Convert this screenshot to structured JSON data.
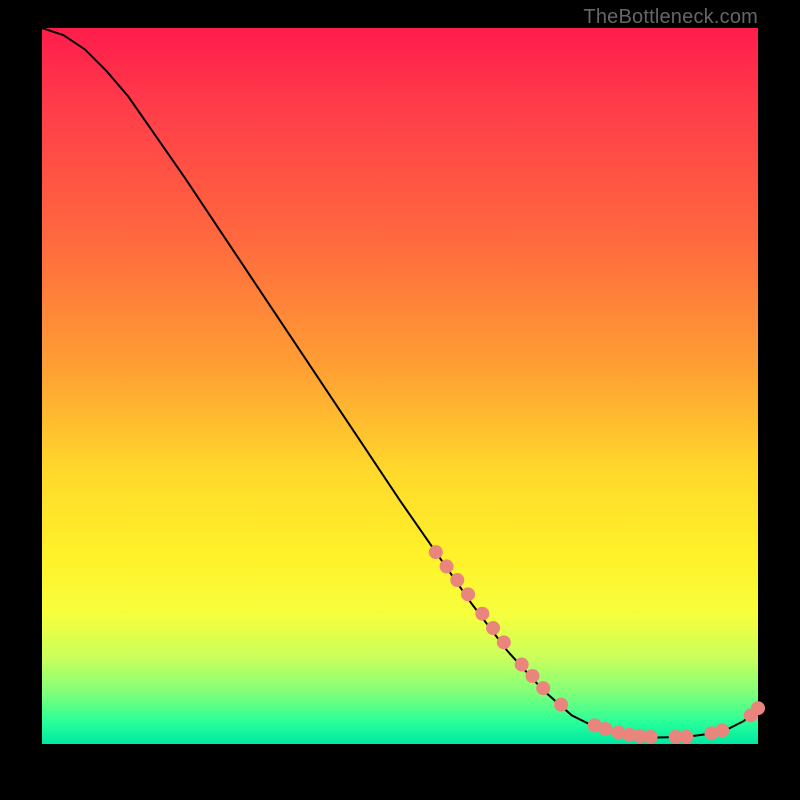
{
  "watermark": "TheBottleneck.com",
  "colors": {
    "background": "#000000",
    "gradient_top": "#ff1c4c",
    "gradient_mid1": "#ff6a3e",
    "gradient_mid2": "#ffd92b",
    "gradient_bottom": "#00e8a3",
    "curve": "#000000",
    "dots": "#e9857d"
  },
  "chart_data": {
    "type": "line",
    "title": "",
    "xlabel": "",
    "ylabel": "",
    "xlim": [
      0,
      100
    ],
    "ylim": [
      0,
      100
    ],
    "grid": false,
    "legend": false,
    "note": "x/y are percentages of the plot box; y origin is the bottom of the gradient. Curve descends from top-left to a flat trough near bottom-right, then ticks upward at the far right.",
    "curve_points": [
      {
        "x": 0,
        "y": 100
      },
      {
        "x": 3,
        "y": 99
      },
      {
        "x": 6,
        "y": 97
      },
      {
        "x": 9,
        "y": 94
      },
      {
        "x": 12,
        "y": 90.5
      },
      {
        "x": 15,
        "y": 86.2
      },
      {
        "x": 20,
        "y": 79
      },
      {
        "x": 25,
        "y": 71.5
      },
      {
        "x": 30,
        "y": 64
      },
      {
        "x": 35,
        "y": 56.5
      },
      {
        "x": 40,
        "y": 49
      },
      {
        "x": 45,
        "y": 41.5
      },
      {
        "x": 50,
        "y": 34
      },
      {
        "x": 55,
        "y": 26.8
      },
      {
        "x": 60,
        "y": 19.6
      },
      {
        "x": 65,
        "y": 13
      },
      {
        "x": 70,
        "y": 7.5
      },
      {
        "x": 74,
        "y": 4
      },
      {
        "x": 78,
        "y": 2
      },
      {
        "x": 82,
        "y": 1.1
      },
      {
        "x": 86,
        "y": 0.9
      },
      {
        "x": 90,
        "y": 1
      },
      {
        "x": 93,
        "y": 1.4
      },
      {
        "x": 96,
        "y": 2.2
      },
      {
        "x": 98,
        "y": 3.2
      },
      {
        "x": 100,
        "y": 5
      }
    ],
    "highlight_dots": [
      {
        "x": 55,
        "y": 26.8
      },
      {
        "x": 56.5,
        "y": 24.8
      },
      {
        "x": 58,
        "y": 22.9
      },
      {
        "x": 59.5,
        "y": 20.9
      },
      {
        "x": 61.5,
        "y": 18.2
      },
      {
        "x": 63,
        "y": 16.2
      },
      {
        "x": 64.5,
        "y": 14.2
      },
      {
        "x": 67,
        "y": 11.1
      },
      {
        "x": 68.5,
        "y": 9.5
      },
      {
        "x": 70,
        "y": 7.8
      },
      {
        "x": 72.5,
        "y": 5.5
      },
      {
        "x": 77.2,
        "y": 2.6
      },
      {
        "x": 78.7,
        "y": 2.1
      },
      {
        "x": 80.5,
        "y": 1.6
      },
      {
        "x": 82,
        "y": 1.3
      },
      {
        "x": 83.5,
        "y": 1.1
      },
      {
        "x": 85,
        "y": 1
      },
      {
        "x": 88.5,
        "y": 1
      },
      {
        "x": 90,
        "y": 1
      },
      {
        "x": 93.5,
        "y": 1.5
      },
      {
        "x": 95,
        "y": 1.9
      },
      {
        "x": 99,
        "y": 4
      },
      {
        "x": 100,
        "y": 5
      }
    ]
  }
}
